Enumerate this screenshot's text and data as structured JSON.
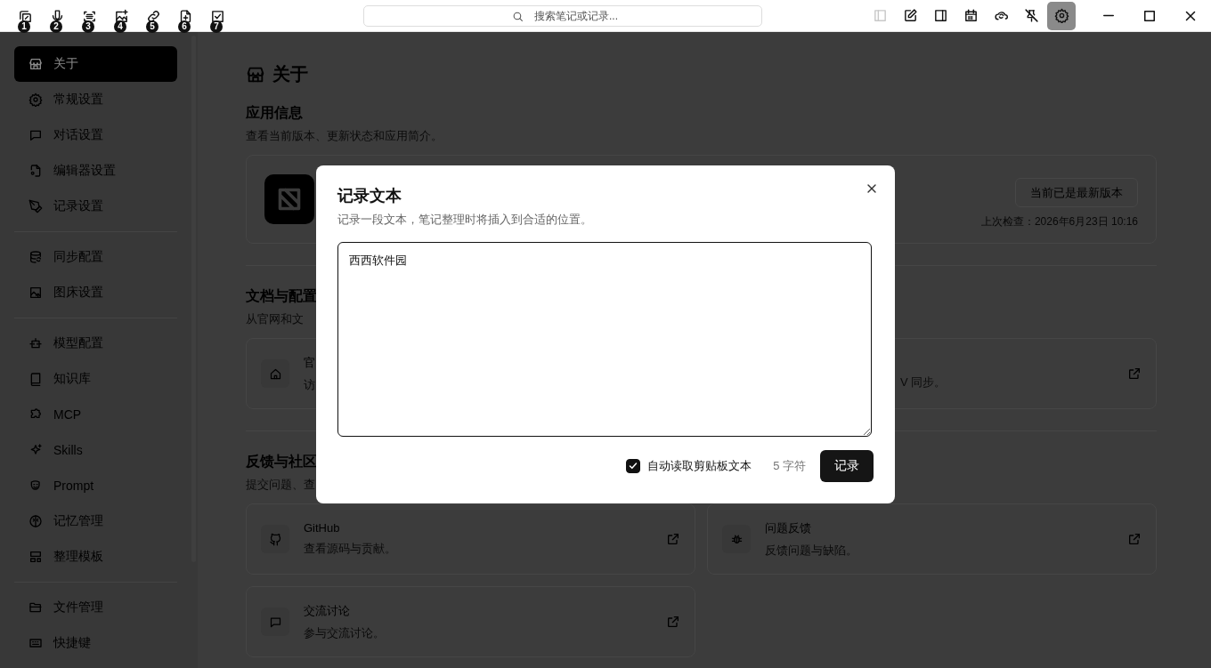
{
  "toolbar": {
    "left_tools": [
      {
        "badge": "1"
      },
      {
        "badge": "2"
      },
      {
        "badge": "3"
      },
      {
        "badge": "4"
      },
      {
        "badge": "5"
      },
      {
        "badge": "6"
      },
      {
        "badge": "7"
      }
    ],
    "search": {
      "placeholder": "搜索笔记或记录..."
    },
    "right_tools": [
      {
        "selected": false,
        "disabled": true
      },
      {
        "selected": false,
        "disabled": false
      },
      {
        "selected": false,
        "disabled": false
      },
      {
        "selected": false,
        "disabled": false
      },
      {
        "selected": false,
        "disabled": false
      },
      {
        "selected": false,
        "disabled": false
      },
      {
        "selected": true,
        "disabled": false
      }
    ]
  },
  "sidebar": {
    "groups": [
      [
        {
          "label": "关于",
          "selected": true
        },
        {
          "label": "常规设置",
          "selected": false
        },
        {
          "label": "对话设置",
          "selected": false
        },
        {
          "label": "编辑器设置",
          "selected": false
        },
        {
          "label": "记录设置",
          "selected": false
        }
      ],
      [
        {
          "label": "同步配置",
          "selected": false
        },
        {
          "label": "图床设置",
          "selected": false
        }
      ],
      [
        {
          "label": "模型配置",
          "selected": false
        },
        {
          "label": "知识库",
          "selected": false
        },
        {
          "label": "MCP",
          "selected": false
        },
        {
          "label": "Skills",
          "selected": false
        },
        {
          "label": "Prompt",
          "selected": false
        },
        {
          "label": "记忆管理",
          "selected": false
        },
        {
          "label": "整理模板",
          "selected": false
        }
      ],
      [
        {
          "label": "文件管理",
          "selected": false
        },
        {
          "label": "快捷键",
          "selected": false
        }
      ]
    ]
  },
  "content": {
    "title": "关于",
    "app_info": {
      "heading": "应用信息",
      "description": "查看当前版本、更新状态和应用简介。",
      "update_button": "当前已是最新版本",
      "last_checked": "上次检查：2026年6月23日 10:16"
    },
    "docs": {
      "heading": "文档与配置",
      "description": "从官网和文",
      "left_card": {
        "title": "官",
        "description": "访"
      },
      "right_card": {
        "description": "V 同步。"
      }
    },
    "feedback": {
      "heading": "反馈与社区",
      "description": "提交问题、查",
      "cards": [
        {
          "title": "GitHub",
          "description": "查看源码与贡献。"
        },
        {
          "title": "问题反馈",
          "description": "反馈问题与缺陷。"
        },
        {
          "title": "交流讨论",
          "description": "参与交流讨论。"
        }
      ]
    }
  },
  "modal": {
    "title": "记录文本",
    "subtitle": "记录一段文本，笔记整理时将插入到合适的位置。",
    "value": "西西软件园",
    "auto_read": {
      "label": "自动读取剪贴板文本",
      "checked": true
    },
    "count": "5 字符",
    "submit": "记录"
  }
}
